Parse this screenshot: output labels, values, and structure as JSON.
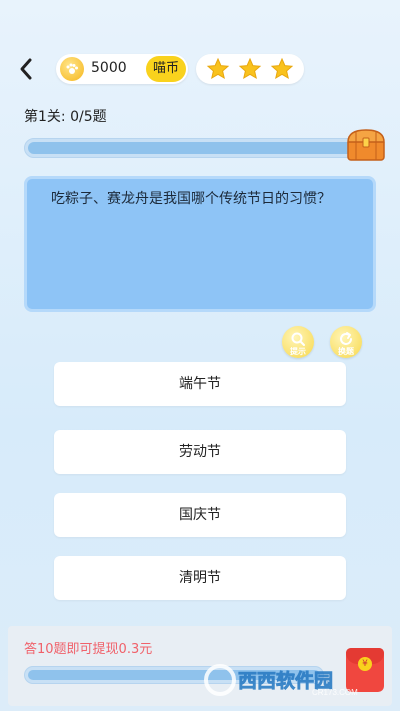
{
  "header": {
    "back_icon": "chevron-left-icon",
    "coins": "5000",
    "coin_unit": "喵币",
    "stars_earned": 3,
    "stars_total": 3
  },
  "level": {
    "label": "第1关: 0/5题",
    "answered": 0,
    "total": 5
  },
  "question": {
    "text": "吃粽子、赛龙舟是我国哪个传统节日的习惯？"
  },
  "tools": {
    "hint_label": "提示",
    "switch_label": "换题"
  },
  "options": [
    {
      "label": "端午节"
    },
    {
      "label": "劳动节"
    },
    {
      "label": "国庆节"
    },
    {
      "label": "清明节"
    }
  ],
  "reward": {
    "text": "答10题即可提现0.3元",
    "progress": 0
  },
  "watermark": {
    "text": "西西软件园",
    "sub": "CR173.COM"
  },
  "colors": {
    "accent_yellow": "#f9d21d",
    "question_bg": "#8ec4f6",
    "reward_text": "#f0616a"
  }
}
